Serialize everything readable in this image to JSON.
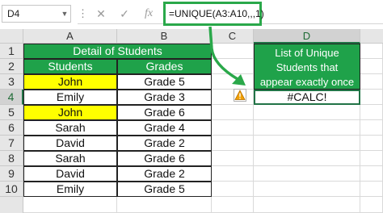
{
  "name_box": {
    "value": "D4",
    "dropdown_icon": "chevron-down-icon"
  },
  "formula_bar": {
    "more_icon": "more-vertical-icon",
    "cancel_icon": "close-icon",
    "enter_icon": "check-icon",
    "fx_label": "fx",
    "formula": "=UNIQUE(A3:A10,,,1)"
  },
  "columns": [
    "A",
    "B",
    "C",
    "D"
  ],
  "rows": [
    "1",
    "2",
    "3",
    "4",
    "5",
    "6",
    "7",
    "8",
    "9",
    "10"
  ],
  "table": {
    "title": "Detail of Students",
    "headers": [
      "Students",
      "Grades"
    ],
    "data": [
      {
        "student": "John",
        "grade": "Grade 5"
      },
      {
        "student": "Emily",
        "grade": "Grade 3"
      },
      {
        "student": "John",
        "grade": "Grade 6"
      },
      {
        "student": "Sarah",
        "grade": "Grade 4"
      },
      {
        "student": "David",
        "grade": "Grade 2"
      },
      {
        "student": "Sarah",
        "grade": "Grade 6"
      },
      {
        "student": "David",
        "grade": "Grade 2"
      },
      {
        "student": "Emily",
        "grade": "Grade 5"
      }
    ]
  },
  "result": {
    "header": "List of Unique Students that appear exactly once",
    "header_lines": [
      "List of Unique",
      "Students that",
      "appear exactly once"
    ],
    "value": "#CALC!",
    "error_icon": "warning-icon"
  },
  "colors": {
    "accent": "#1fa24a",
    "highlight": "#ffff00",
    "annotation": "#2aa84a"
  }
}
